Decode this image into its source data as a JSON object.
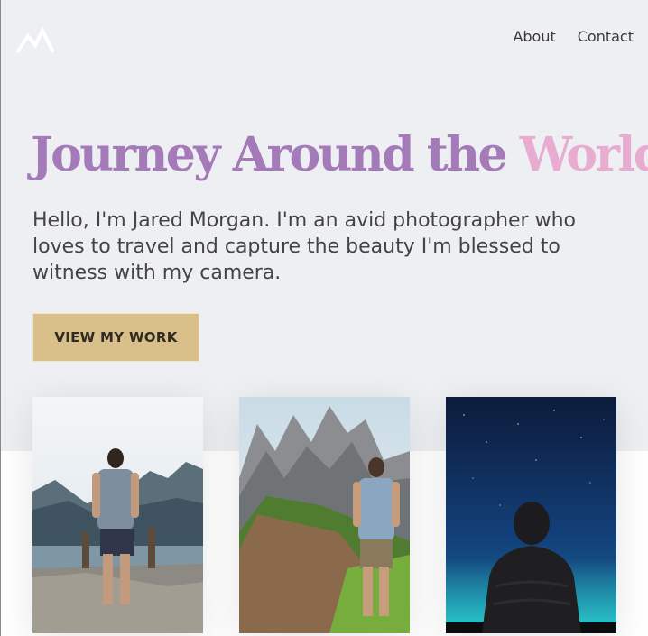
{
  "header": {
    "logo_icon": "mountain-logo-icon",
    "nav": [
      {
        "label": "About"
      },
      {
        "label": "Contact"
      }
    ]
  },
  "hero": {
    "title_main": "Journey Around the",
    "title_accent": "World",
    "intro": "Hello, I'm Jared Morgan. I'm an avid photographer who loves to travel and capture the beauty I'm blessed to witness with my camera.",
    "cta_label": "VIEW MY WORK"
  },
  "gallery": [
    {
      "icon": "hiker-lake-photo"
    },
    {
      "icon": "hiker-mountain-photo"
    },
    {
      "icon": "night-sky-photo"
    }
  ],
  "colors": {
    "hero_background": "#eeeff3",
    "title": "#a47bb8",
    "title_accent": "#e8acd1",
    "button": "#d9c08a",
    "text": "#444444"
  }
}
